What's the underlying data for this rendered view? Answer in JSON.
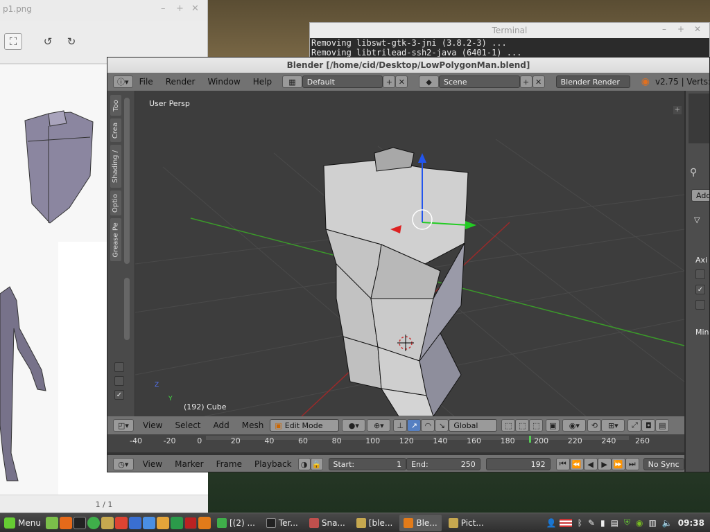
{
  "viewer": {
    "title": "p1.png",
    "page_indicator": "1 / 1",
    "fit_icon": "fit-to-window-icon",
    "rotate_left_icon": "rotate-left-icon",
    "rotate_right_icon": "rotate-right-icon"
  },
  "terminal": {
    "title": "Terminal",
    "lines": [
      "Removing libswt-gtk-3-jni (3.8.2-3) ...",
      "Removing libtrilead-ssh2-java (6401-1) ..."
    ]
  },
  "blender": {
    "title": "Blender [/home/cid/Desktop/LowPolygonMan.blend]",
    "menus": [
      "File",
      "Render",
      "Window",
      "Help"
    ],
    "layout": "Default",
    "scene": "Scene",
    "engine": "Blender Render",
    "version": "v2.75 | Verts:",
    "viewport_label": "User Persp",
    "object_label": "(192) Cube",
    "axis_z": "Z",
    "axis_y": "Y",
    "toolshelf_tabs": [
      "Too",
      "Crea",
      "Shading /",
      "Optio",
      "Grease Pe"
    ],
    "view3d_menus": [
      "View",
      "Select",
      "Add",
      "Mesh"
    ],
    "mode": "Edit Mode",
    "orientation": "Global",
    "timeline_ticks": [
      "-40",
      "-20",
      "0",
      "20",
      "40",
      "60",
      "80",
      "100",
      "120",
      "140",
      "160",
      "180",
      "200",
      "220",
      "240",
      "260"
    ],
    "timeline_menus": [
      "View",
      "Marker",
      "Frame",
      "Playback"
    ],
    "start_label": "Start:",
    "start_value": "1",
    "end_label": "End:",
    "end_value": "250",
    "current_frame": "192",
    "sync": "No Sync",
    "right_panel": {
      "add": "Add",
      "axis": "Axi",
      "min": "Min"
    }
  },
  "taskbar": {
    "menu": "Menu",
    "tasks": [
      "[(2) ...",
      "Ter...",
      "Sna...",
      "[ble...",
      "Ble...",
      "Pict..."
    ],
    "clock": "09:38"
  },
  "colors": {
    "accent": "#5680c2",
    "x_axis": "#cc3333",
    "y_axis": "#33cc33",
    "z_axis": "#2255ee",
    "mesh": "#c8c8c8"
  }
}
